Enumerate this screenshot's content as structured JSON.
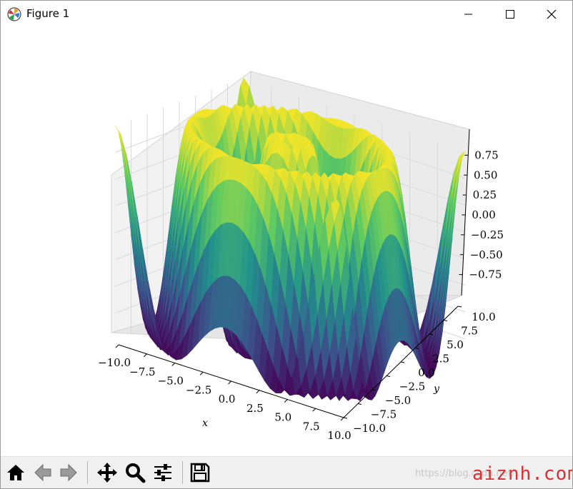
{
  "window": {
    "title": "Figure 1",
    "controls": {
      "minimize": "minimize",
      "maximize": "maximize",
      "close": "close"
    }
  },
  "toolbar": {
    "buttons": [
      {
        "name": "home",
        "icon": "home-icon"
      },
      {
        "name": "back",
        "icon": "arrow-left-icon"
      },
      {
        "name": "forward",
        "icon": "arrow-right-icon"
      },
      {
        "name": "pan",
        "icon": "move-icon"
      },
      {
        "name": "zoom",
        "icon": "magnifier-icon"
      },
      {
        "name": "configure-subplots",
        "icon": "sliders-icon"
      },
      {
        "name": "save",
        "icon": "floppy-disk-icon"
      }
    ]
  },
  "chart_data": {
    "type": "surface3d",
    "title": "",
    "xlabel": "x",
    "ylabel": "y",
    "zlabel": "",
    "colormap": "viridis",
    "colormap_stops": [
      "#440154",
      "#3b528b",
      "#21918c",
      "#5ec962",
      "#fde725"
    ],
    "x_range": [
      -10,
      10
    ],
    "y_range": [
      -10,
      10
    ],
    "z_range": [
      -1,
      1
    ],
    "x_ticks": [
      "−10.0",
      "−7.5",
      "−5.0",
      "−2.5",
      "0.0",
      "2.5",
      "5.0",
      "7.5",
      "10.0"
    ],
    "y_ticks": [
      "−10.0",
      "−7.5",
      "−5.0",
      "−2.5",
      "0.0",
      "2.5",
      "5.0",
      "7.5",
      "10.0"
    ],
    "z_ticks": [
      "0.75",
      "0.50",
      "0.25",
      "0.00",
      "−0.25",
      "−0.50",
      "−0.75"
    ],
    "surface": "z = sin(sqrt(x^2 + y^2))",
    "grid": true
  },
  "watermark": {
    "url": "https://blog.csdn.net/..",
    "brand": "aiznh.com"
  }
}
